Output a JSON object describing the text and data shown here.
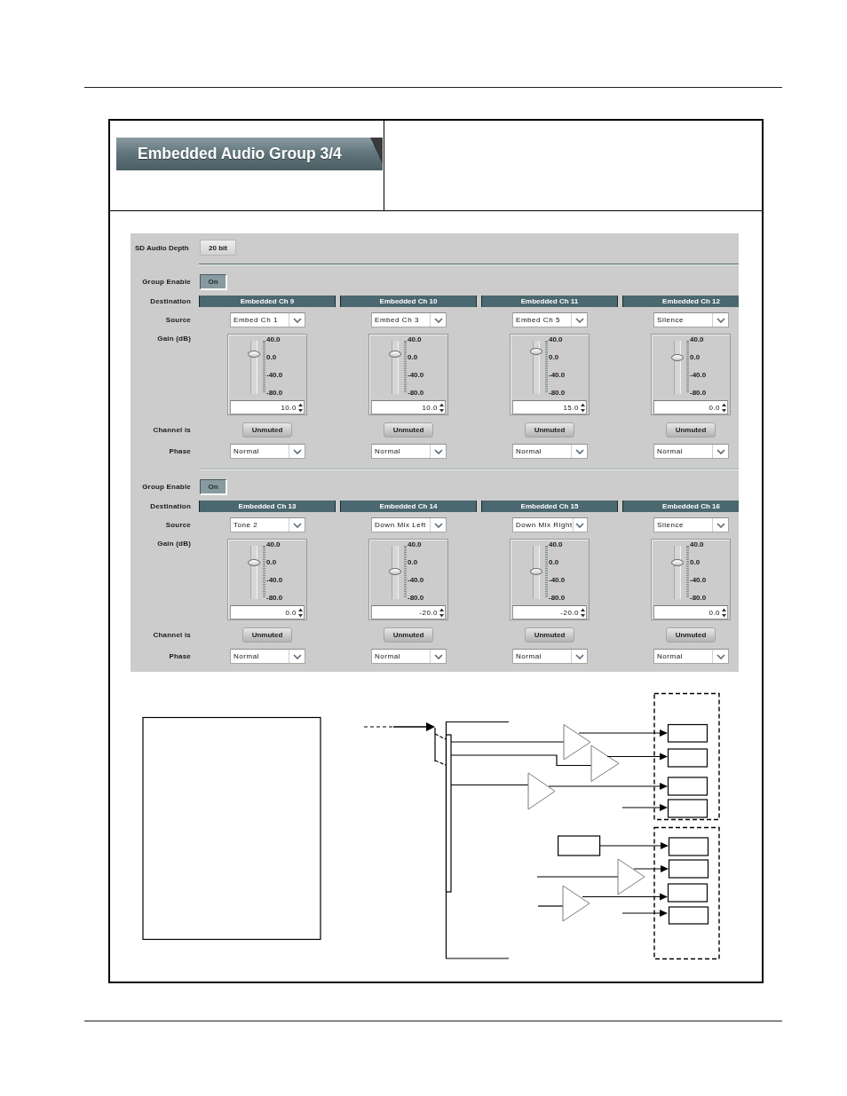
{
  "header": {
    "title": "Embedded Audio Group 3/4"
  },
  "panel": {
    "sd_audio_depth": {
      "label": "SD Audio Depth",
      "value": "20 bit"
    },
    "groups": [
      {
        "enable_label": "Group Enable",
        "enable": {
          "label": "On",
          "on": true
        },
        "row_labels": {
          "destination": "Destination",
          "source": "Source",
          "gain": "Gain (dB)",
          "channel": "Channel is",
          "phase": "Phase"
        },
        "channels": [
          {
            "destination": "Embedded Ch 9",
            "source": "Embed Ch 1",
            "scale": [
              "40.0",
              "0.0",
              "-40.0",
              "-80.0"
            ],
            "level": 0.75,
            "gain": "10.0",
            "mute_button": "Unmuted",
            "phase": "Normal"
          },
          {
            "destination": "Embedded Ch 10",
            "source": "Embed Ch 3",
            "scale": [
              "40.0",
              "0.0",
              "-40.0",
              "-80.0"
            ],
            "level": 0.75,
            "gain": "10.0",
            "mute_button": "Unmuted",
            "phase": "Normal"
          },
          {
            "destination": "Embedded Ch 11",
            "source": "Embed Ch 5",
            "scale": [
              "40.0",
              "0.0",
              "-40.0",
              "-80.0"
            ],
            "level": 0.79,
            "gain": "15.0",
            "mute_button": "Unmuted",
            "phase": "Normal"
          },
          {
            "destination": "Embedded Ch 12",
            "source": "Silence",
            "scale": [
              "40.0",
              "0.0",
              "-40.0",
              "-80.0"
            ],
            "level": 0.67,
            "gain": "0.0",
            "mute_button": "Unmuted",
            "phase": "Normal"
          }
        ]
      },
      {
        "enable_label": "Group Enable",
        "enable": {
          "label": "On",
          "on": true
        },
        "row_labels": {
          "destination": "Destination",
          "source": "Source",
          "gain": "Gain (dB)",
          "channel": "Channel is",
          "phase": "Phase"
        },
        "channels": [
          {
            "destination": "Embedded Ch 13",
            "source": "Tone 2",
            "scale": [
              "40.0",
              "0.0",
              "-40.0",
              "-80.0"
            ],
            "level": 0.67,
            "gain": "0.0",
            "mute_button": "Unmuted",
            "phase": "Normal"
          },
          {
            "destination": "Embedded Ch 14",
            "source": "Down Mix Left",
            "scale": [
              "40.0",
              "0.0",
              "-40.0",
              "-80.0"
            ],
            "level": 0.5,
            "gain": "-20.0",
            "mute_button": "Unmuted",
            "phase": "Normal"
          },
          {
            "destination": "Embedded Ch 15",
            "source": "Down Mix Right",
            "scale": [
              "40.0",
              "0.0",
              "-40.0",
              "-80.0"
            ],
            "level": 0.5,
            "gain": "-20.0",
            "mute_button": "Unmuted",
            "phase": "Normal"
          },
          {
            "destination": "Embedded Ch 16",
            "source": "Silence",
            "scale": [
              "40.0",
              "0.0",
              "-40.0",
              "-80.0"
            ],
            "level": 0.67,
            "gain": "0.0",
            "mute_button": "Unmuted",
            "phase": "Normal"
          }
        ]
      }
    ]
  }
}
